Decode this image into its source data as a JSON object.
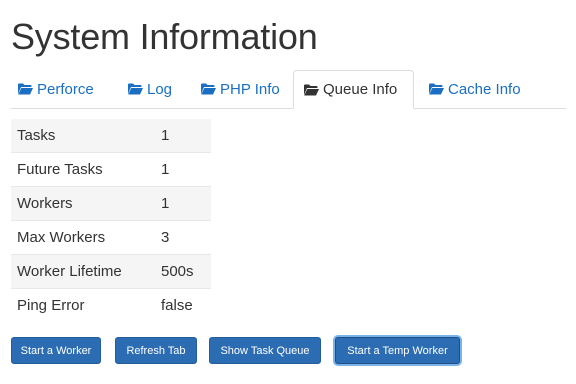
{
  "page": {
    "title": "System Information"
  },
  "tabs": [
    {
      "label": "Perforce",
      "active": false,
      "icon": "folder-icon"
    },
    {
      "label": "Log",
      "active": false,
      "icon": "folder-icon"
    },
    {
      "label": "PHP Info",
      "active": false,
      "icon": "folder-icon"
    },
    {
      "label": "Queue Info",
      "active": true,
      "icon": "folder-open-icon"
    },
    {
      "label": "Cache Info",
      "active": false,
      "icon": "folder-icon"
    }
  ],
  "queue_info": [
    {
      "label": "Tasks",
      "value": "1"
    },
    {
      "label": "Future Tasks",
      "value": "1"
    },
    {
      "label": "Workers",
      "value": "1"
    },
    {
      "label": "Max Workers",
      "value": "3"
    },
    {
      "label": "Worker Lifetime",
      "value": "500s"
    },
    {
      "label": "Ping Error",
      "value": "false"
    }
  ],
  "buttons": {
    "start_worker": "Start a Worker",
    "refresh_tab": "Refresh Tab",
    "show_task_queue": "Show Task Queue",
    "start_temp_worker": "Start a Temp Worker"
  },
  "colors": {
    "link": "#1a6fc2",
    "button": "#2b6cb3",
    "row_stripe": "#f5f5f5"
  }
}
